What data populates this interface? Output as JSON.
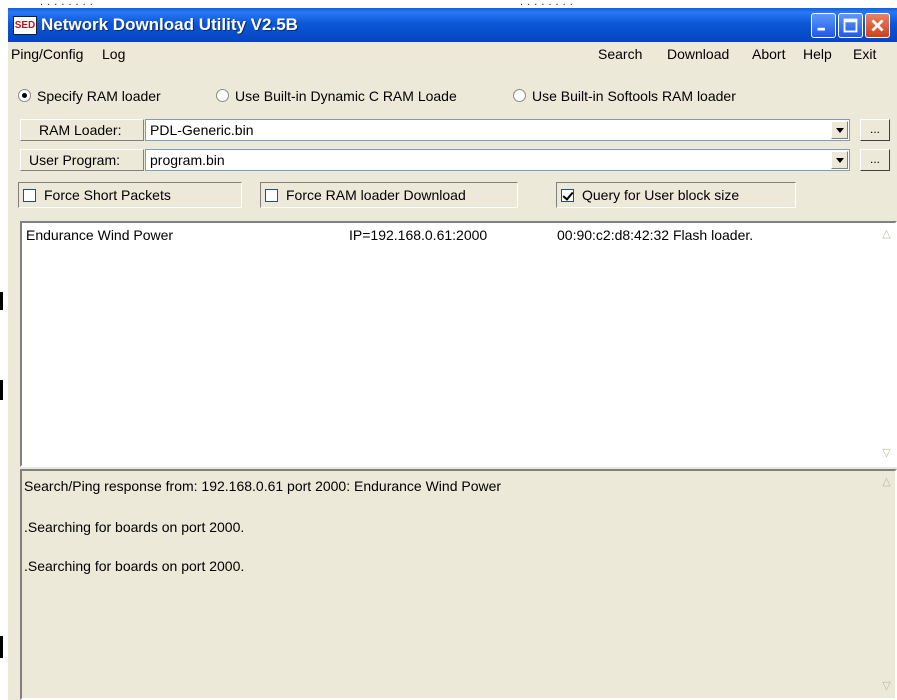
{
  "window": {
    "title": "Network Download Utility V2.5B",
    "icon_text": "SED",
    "controls": [
      "minimize",
      "maximize",
      "close"
    ]
  },
  "menu": {
    "left": [
      "Ping/Config",
      "Log"
    ],
    "right": [
      "Search",
      "Download",
      "Abort",
      "Help",
      "Exit"
    ]
  },
  "loader_options": {
    "specify": "Specify RAM loader",
    "dynamic_c": "Use Built-in Dynamic C RAM Loade",
    "softools": "Use Built-in Softools  RAM loader",
    "selected": "specify"
  },
  "ram_loader": {
    "label": "RAM Loader:",
    "value": "PDL-Generic.bin",
    "browse": "..."
  },
  "user_program": {
    "label": "User Program:",
    "value": "program.bin",
    "browse": "..."
  },
  "options": {
    "force_short_packets": {
      "label": "Force Short Packets",
      "checked": false
    },
    "force_ram_loader": {
      "label": "Force RAM loader Download",
      "checked": false
    },
    "query_user_block": {
      "label": "Query for User block size",
      "checked": true
    }
  },
  "boards": [
    {
      "name": "Endurance Wind Power",
      "ip": "IP=192.168.0.61:2000",
      "info": "00:90:c2:d8:42:32 Flash loader."
    }
  ],
  "log": [
    "Search/Ping response from: 192.168.0.61 port 2000: Endurance Wind Power",
    ".Searching for boards on port 2000.",
    ".Searching for boards on port 2000."
  ],
  "colors": {
    "titlebar": "#0b58d8",
    "face": "#ece9d8",
    "close": "#c9431a"
  }
}
